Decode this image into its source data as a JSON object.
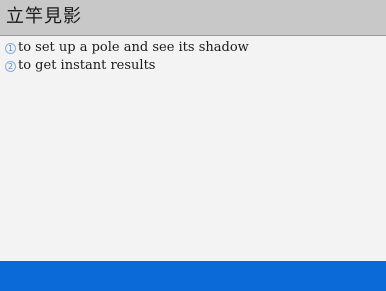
{
  "header": {
    "title": "立竿見影"
  },
  "definitions": [
    {
      "number": "1",
      "text": "to set up a pole and see its shadow"
    },
    {
      "number": "2",
      "text": "to get instant results"
    }
  ],
  "colors": {
    "title_bar": "#c8c8c8",
    "content_bg": "#f3f3f3",
    "status_bar": "#0b6ad8",
    "number_icon": "#5a86c8"
  },
  "icons": [
    "circled-number-1-icon",
    "circled-number-2-icon"
  ]
}
